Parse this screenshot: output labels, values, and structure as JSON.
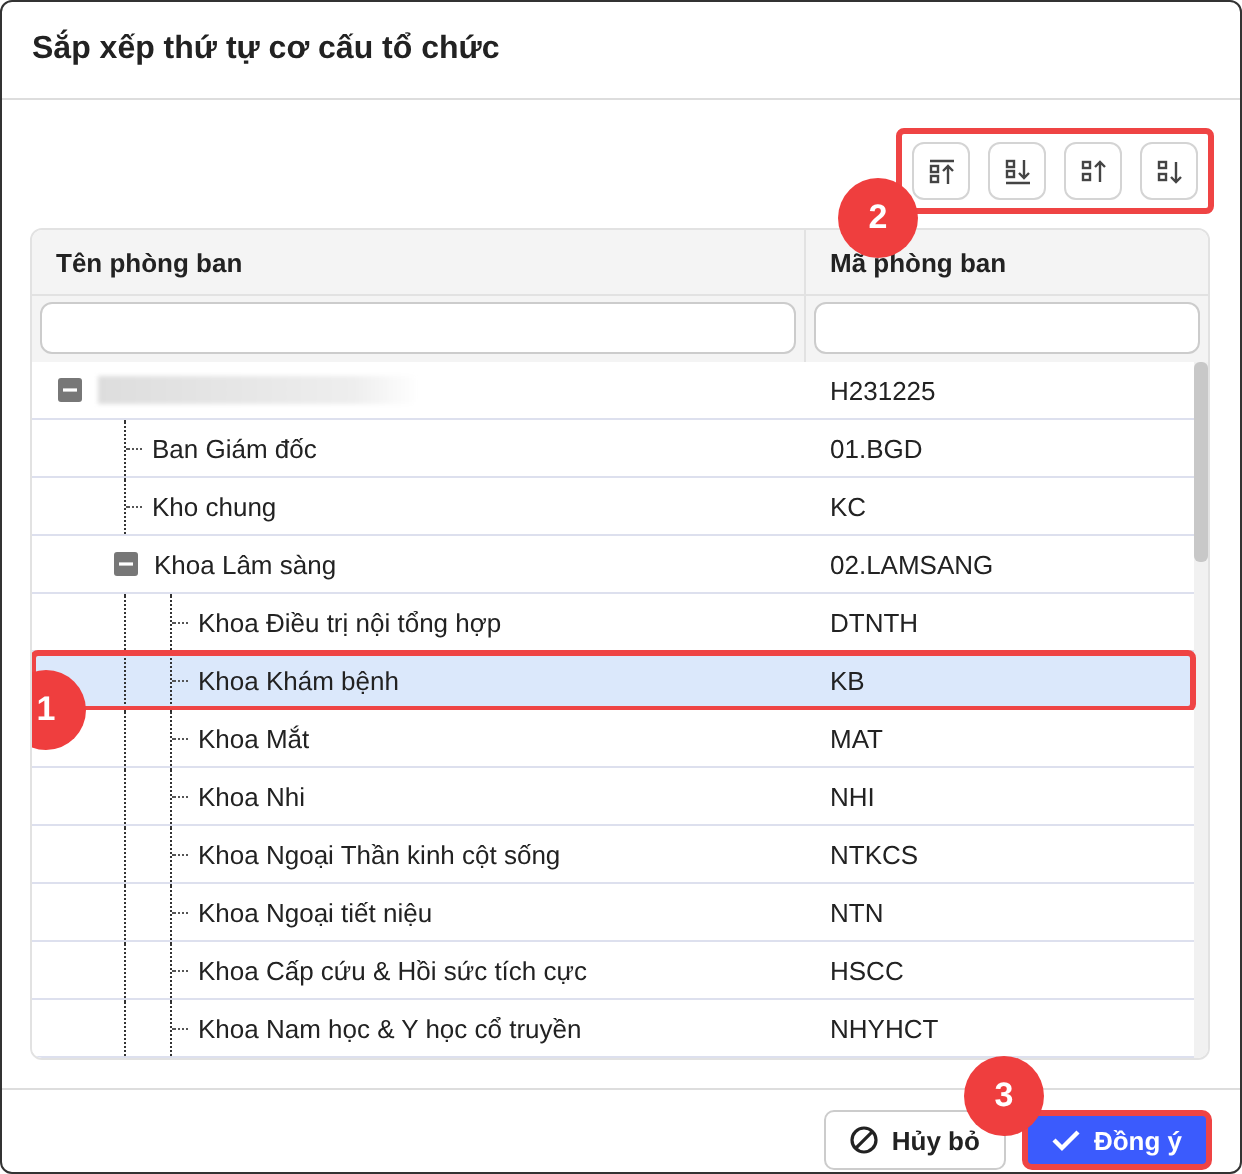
{
  "dialog": {
    "title": "Sắp xếp thứ tự cơ cấu tổ chức"
  },
  "toolbar": {
    "callout": "2",
    "buttons": [
      {
        "kind": "move-top"
      },
      {
        "kind": "move-bottom"
      },
      {
        "kind": "move-up"
      },
      {
        "kind": "move-down"
      }
    ]
  },
  "table": {
    "columns": [
      {
        "label": "Tên phòng ban"
      },
      {
        "label": "Mã phòng ban"
      }
    ],
    "rows": [
      {
        "redacted": true,
        "code": "H231225",
        "expanded": true,
        "selected": false,
        "children": [
          {
            "name": "Ban Giám đốc",
            "code": "01.BGD",
            "selected": false
          },
          {
            "name": "Kho chung",
            "code": "KC",
            "selected": false
          },
          {
            "name": "Khoa Lâm sàng",
            "code": "02.LAMSANG",
            "expanded": true,
            "selected": false,
            "children": [
              {
                "name": "Khoa Điều trị nội tổng hợp",
                "code": "DTNTH",
                "selected": false
              },
              {
                "name": "Khoa Khám bệnh",
                "code": "KB",
                "selected": true,
                "callout": "1"
              },
              {
                "name": "Khoa Mắt",
                "code": "MAT",
                "selected": false
              },
              {
                "name": "Khoa Nhi",
                "code": "NHI",
                "selected": false
              },
              {
                "name": "Khoa Ngoại Thần kinh cột sống",
                "code": "NTKCS",
                "selected": false
              },
              {
                "name": "Khoa Ngoại tiết niệu",
                "code": "NTN",
                "selected": false
              },
              {
                "name": "Khoa Cấp cứu & Hồi sức tích cực",
                "code": "HSCC",
                "selected": false
              },
              {
                "name": "Khoa Nam học & Y học cổ truyền",
                "code": "NHYHCT",
                "selected": false
              }
            ]
          }
        ]
      }
    ]
  },
  "footer": {
    "cancel": {
      "label": "Hủy bỏ"
    },
    "confirm": {
      "label": "Đồng ý",
      "callout": "3"
    }
  }
}
